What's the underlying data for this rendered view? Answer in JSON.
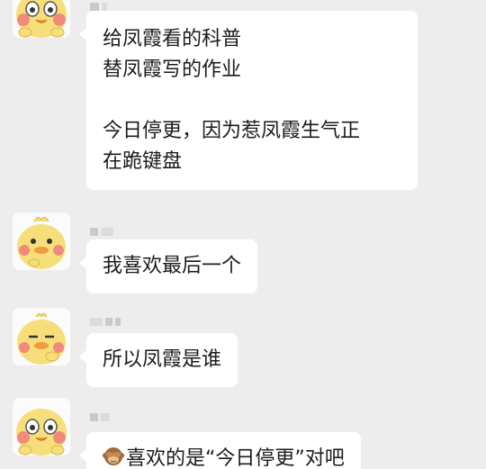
{
  "colors": {
    "chat_background": "#ededed",
    "bubble_background": "#ffffff",
    "text": "#1b1b1b",
    "redacted_name": "#c9c9c9"
  },
  "messages": [
    {
      "avatar": "cartoon-duck-avatar",
      "lines": [
        "给凤霞看的科普",
        "替凤霞写的作业",
        "",
        "今日停更，因为惹凤霞生气正",
        "在跪键盘"
      ]
    },
    {
      "avatar": "cartoon-duck-avatar",
      "lines": [
        "我喜欢最后一个"
      ]
    },
    {
      "avatar": "cartoon-duck-avatar",
      "lines": [
        "所以凤霞是谁"
      ]
    },
    {
      "avatar": "cartoon-duck-avatar",
      "emoji": "see-no-evil-monkey-icon",
      "lines": [
        "喜欢的是“今日停更”对吧"
      ]
    }
  ]
}
